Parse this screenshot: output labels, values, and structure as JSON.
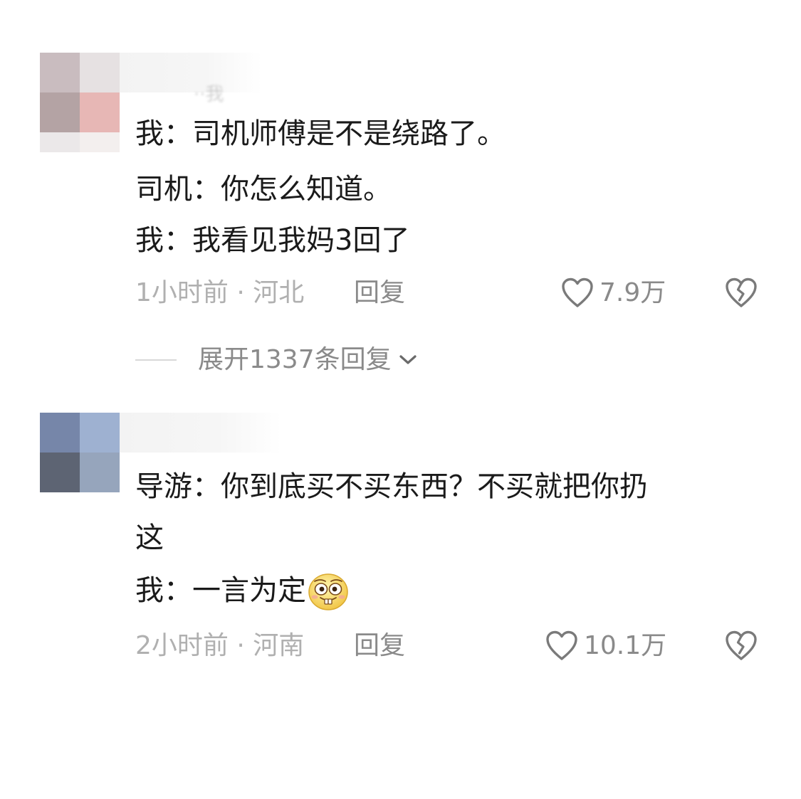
{
  "comments": [
    {
      "username": "··我",
      "lines": [
        "我：司机师傅是不是绕路了。",
        "司机：你怎么知道。",
        "我：我看见我妈3回了"
      ],
      "meta": "1小时前 · 河北",
      "reply_label": "回复",
      "likes": "7.9万",
      "like_icon": "heart-outline-icon",
      "dislike_icon": "broken-heart-icon",
      "avatar_colors": [
        "#c9bcbf",
        "#e6e1e2",
        "#b4a3a4",
        "#e7b7b5",
        "#ebe8e9",
        "#f3efee"
      ],
      "expand_label": "展开1337条回复"
    },
    {
      "lines": [
        "导游：你到底买不买东西？不买就把你扔",
        "这",
        "我：一言为定"
      ],
      "emoji": "grinning-buck-teeth-emoji",
      "meta": "2小时前 · 河南",
      "reply_label": "回复",
      "likes": "10.1万",
      "like_icon": "heart-outline-icon",
      "dislike_icon": "broken-heart-icon",
      "avatar_colors": [
        "#7686a9",
        "#9eb1d1",
        "#5d6473",
        "#96a5bc"
      ]
    }
  ],
  "colors": {
    "text": "#1a1a1a",
    "meta": "#b0b0b0",
    "action": "#8a8a8a",
    "icon": "#7a7a7a"
  }
}
